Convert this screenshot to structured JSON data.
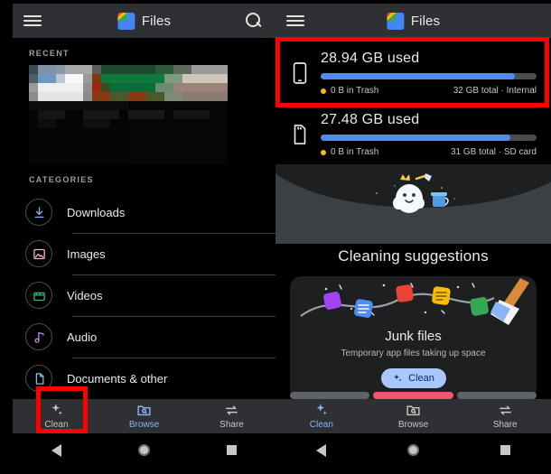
{
  "app": {
    "name": "Files",
    "logo_icon": "files-logo-icon",
    "menu_icon": "hamburger-menu-icon",
    "search_icon": "search-icon"
  },
  "left_panel": {
    "recent": {
      "label": "RECENT",
      "thumbnails": [
        {
          "name": "recent-thumbnail-1",
          "palette": [
            "#7d9ec4",
            "#f5f5f5",
            "#9a9a9a"
          ]
        },
        {
          "name": "recent-thumbnail-2",
          "palette": [
            "#1d5c34",
            "#0f7a3d",
            "#8a3a12"
          ]
        }
      ]
    },
    "categories": {
      "label": "CATEGORIES",
      "items": [
        {
          "label": "Downloads",
          "icon": "download-icon",
          "color": "#8ab4f8"
        },
        {
          "label": "Images",
          "icon": "image-icon",
          "color": "#f4b6c2"
        },
        {
          "label": "Videos",
          "icon": "video-icon",
          "color": "#4caf6d"
        },
        {
          "label": "Audio",
          "icon": "audio-note-icon",
          "color": "#c58af9"
        },
        {
          "label": "Documents & other",
          "icon": "document-icon",
          "color": "#7cc4e8"
        }
      ]
    },
    "bottom_nav": {
      "items": [
        {
          "label": "Clean",
          "icon": "sparkle-icon",
          "active": false
        },
        {
          "label": "Browse",
          "icon": "browse-folder-icon",
          "active": true
        },
        {
          "label": "Share",
          "icon": "share-arrows-icon",
          "active": false
        }
      ]
    }
  },
  "right_panel": {
    "storage": [
      {
        "title": "28.94 GB used",
        "device_icon": "phone-icon",
        "trash": "0 B in Trash",
        "total": "32 GB total · Internal",
        "percent": 90,
        "bar_color": "#4d8df5",
        "track_color": "#4a4d50",
        "trash_dot_color": "#fbbc04"
      },
      {
        "title": "27.48 GB used",
        "device_icon": "sd-card-icon",
        "trash": "0 B in Trash",
        "total": "31 GB total · SD card",
        "percent": 88,
        "bar_color": "#4d8df5",
        "track_color": "#4a4d50",
        "trash_dot_color": "#fbbc04"
      }
    ],
    "cleaning": {
      "hero_title": "Cleaning suggestions",
      "mascot_icon": "cleaning-mascot-icon",
      "suggestion": {
        "title": "Junk files",
        "subtitle": "Temporary app files taking up space",
        "button_label": "Clean",
        "button_icon": "sparkle-icon",
        "button_color": "#a8c7fa",
        "art_icon": "junk-files-sweep-icon"
      }
    },
    "page_indicator": {
      "segments": 3,
      "active_index": 1,
      "active_color": "#f0576e"
    },
    "bottom_nav": {
      "items": [
        {
          "label": "Clean",
          "icon": "sparkle-icon",
          "active": true
        },
        {
          "label": "Browse",
          "icon": "browse-folder-icon",
          "active": false
        },
        {
          "label": "Share",
          "icon": "share-arrows-icon",
          "active": false
        }
      ]
    }
  },
  "system_nav": {
    "back_icon": "back-triangle-icon",
    "home_icon": "home-circle-icon",
    "recents_icon": "recents-square-icon"
  },
  "annotations": {
    "highlight_color": "#fe0000",
    "boxes": [
      {
        "name": "storage-card-highlight",
        "target": "28.94 GB used card"
      },
      {
        "name": "clean-tab-highlight",
        "target": "Clean bottom nav tab"
      }
    ]
  }
}
